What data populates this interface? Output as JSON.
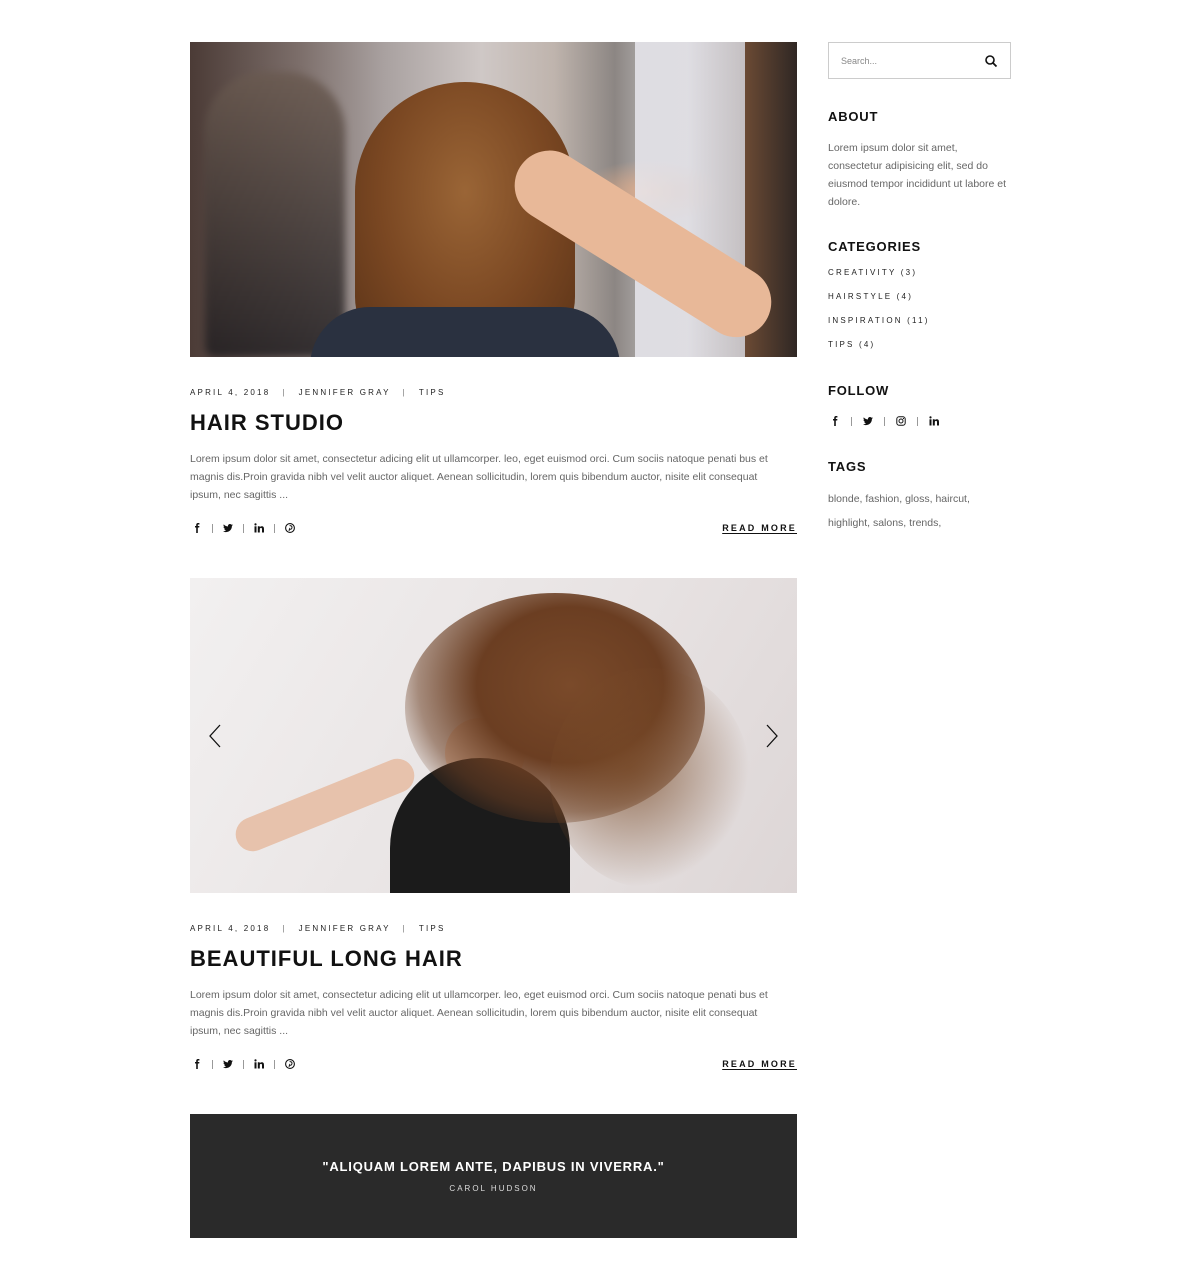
{
  "posts": [
    {
      "date": "APRIL 4, 2018",
      "author": "JENNIFER GRAY",
      "category": "TIPS",
      "title": "HAIR STUDIO",
      "excerpt": "Lorem ipsum dolor sit amet, consectetur adicing elit ut ullamcorper. leo, eget euismod orci. Cum sociis natoque penati bus et magnis dis.Proin gravida nibh vel velit auctor aliquet. Aenean sollicitudin, lorem quis bibendum auctor, nisite elit consequat ipsum, nec sagittis ...",
      "read_more": "READ MORE",
      "share_icons": [
        "facebook-icon",
        "twitter-icon",
        "linkedin-icon",
        "pinterest-icon"
      ]
    },
    {
      "date": "APRIL 4, 2018",
      "author": "JENNIFER GRAY",
      "category": "TIPS",
      "title": "BEAUTIFUL LONG HAIR",
      "excerpt": "Lorem ipsum dolor sit amet, consectetur adicing elit ut ullamcorper. leo, eget euismod orci. Cum sociis natoque penati bus et magnis dis.Proin gravida nibh vel velit auctor aliquet. Aenean sollicitudin, lorem quis bibendum auctor, nisite elit consequat ipsum, nec sagittis ...",
      "read_more": "READ MORE",
      "share_icons": [
        "facebook-icon",
        "twitter-icon",
        "linkedin-icon",
        "pinterest-icon"
      ],
      "slider_arrows": [
        "chevron-left-icon",
        "chevron-right-icon"
      ]
    }
  ],
  "quote": {
    "text": "\"ALIQUAM LOREM ANTE, DAPIBUS IN VIVERRA.\"",
    "author": "CAROL HUDSON"
  },
  "sidebar": {
    "search": {
      "placeholder": "Search...",
      "icon": "search-icon"
    },
    "about": {
      "title": "ABOUT",
      "text": "Lorem ipsum dolor sit amet, consectetur adipisicing elit, sed do eiusmod tempor incididunt ut labore et dolore."
    },
    "categories": {
      "title": "CATEGORIES",
      "items": [
        "CREATIVITY (3)",
        "HAIRSTYLE (4)",
        "INSPIRATION (11)",
        "TIPS (4)"
      ]
    },
    "follow": {
      "title": "FOLLOW",
      "icons": [
        "facebook-icon",
        "twitter-icon",
        "instagram-icon",
        "linkedin-icon"
      ]
    },
    "tags": {
      "title": "TAGS",
      "items": [
        "blonde,",
        "fashion,",
        "gloss,",
        "haircut,",
        "highlight,",
        "salons,",
        "trends,"
      ]
    }
  },
  "colors": {
    "text_dark": "#111111",
    "text_muted": "#666666",
    "quote_bg": "#2a2a2a"
  }
}
